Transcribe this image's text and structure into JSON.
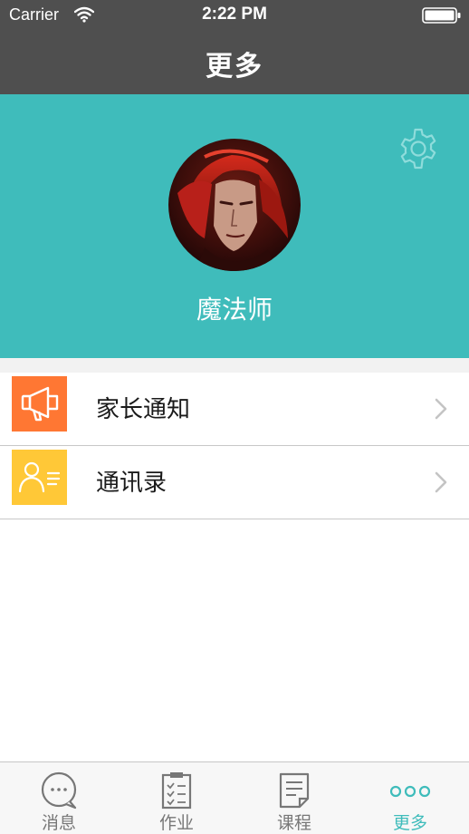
{
  "status_bar": {
    "carrier": "Carrier",
    "time": "2:22 PM"
  },
  "nav": {
    "title": "更多"
  },
  "profile": {
    "name": "魔法师",
    "settings_icon": "gear-icon",
    "background": "#3fbcbb"
  },
  "menu": [
    {
      "label": "家长通知",
      "icon": "megaphone-icon",
      "icon_color": "#ff7733"
    },
    {
      "label": "通讯录",
      "icon": "contacts-icon",
      "icon_color": "#ffc837"
    }
  ],
  "tabs": [
    {
      "label": "消息",
      "icon": "message-bubble-icon",
      "active": false
    },
    {
      "label": "作业",
      "icon": "clipboard-checklist-icon",
      "active": false
    },
    {
      "label": "课程",
      "icon": "document-icon",
      "active": false
    },
    {
      "label": "更多",
      "icon": "more-dots-icon",
      "active": true
    }
  ],
  "colors": {
    "header": "#4f4f4f",
    "accent": "#3fbcbb",
    "tab_inactive": "#777777"
  }
}
